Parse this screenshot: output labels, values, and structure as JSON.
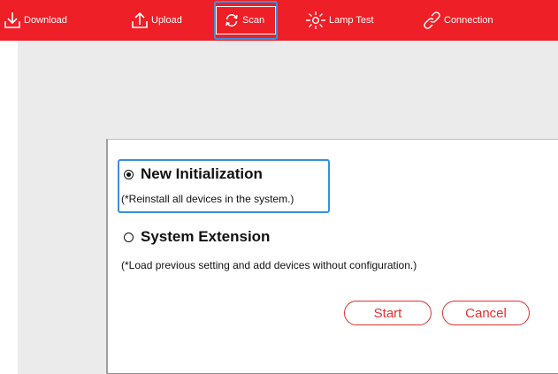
{
  "toolbar": {
    "items": [
      {
        "label": "Download",
        "icon": "download-icon"
      },
      {
        "label": "Upload",
        "icon": "upload-icon"
      },
      {
        "label": "Scan",
        "icon": "refresh-icon"
      },
      {
        "label": "Lamp Test",
        "icon": "lamp-icon"
      },
      {
        "label": "Connection",
        "icon": "link-icon"
      }
    ],
    "active": "Scan",
    "background_color": "#ee1f26",
    "highlight_color": "#3a8fdc"
  },
  "dialog": {
    "options": [
      {
        "label": "New Initialization",
        "description": "(*Reinstall all devices in the system.)",
        "selected": true
      },
      {
        "label": "System Extension",
        "description": "(*Load previous setting and add devices without configuration.)",
        "selected": false
      }
    ],
    "buttons": {
      "start": "Start",
      "cancel": "Cancel"
    },
    "button_color": "#e0302f"
  }
}
